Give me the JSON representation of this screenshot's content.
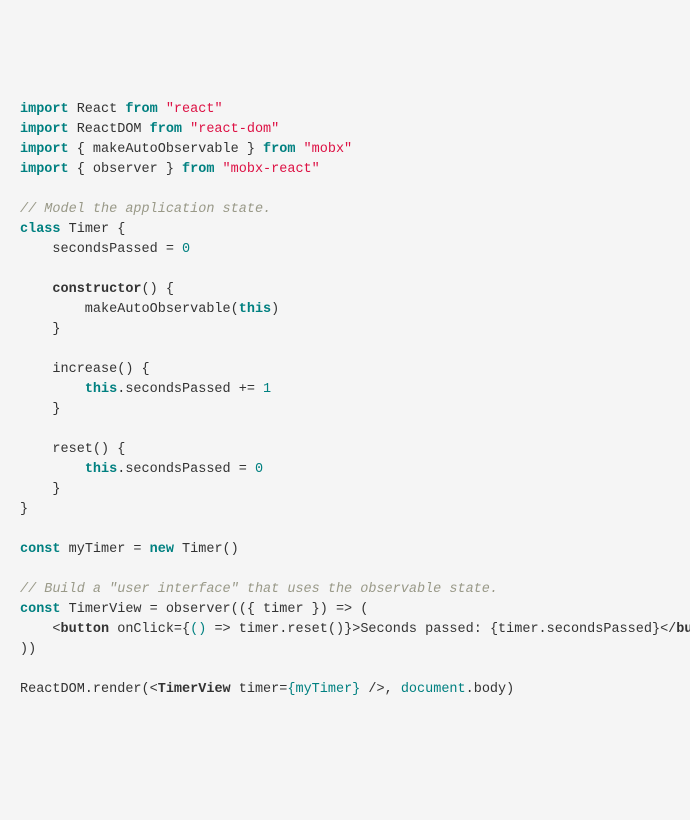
{
  "code": {
    "l1_kw1": "import",
    "l1_id": " React ",
    "l1_kw2": "from",
    "l1_str": " \"react\"",
    "l2_kw1": "import",
    "l2_id": " ReactDOM ",
    "l2_kw2": "from",
    "l2_str": " \"react-dom\"",
    "l3_kw1": "import",
    "l3_id": " { makeAutoObservable } ",
    "l3_kw2": "from",
    "l3_str": " \"mobx\"",
    "l4_kw1": "import",
    "l4_id": " { observer } ",
    "l4_kw2": "from",
    "l4_str": " \"mobx-react\"",
    "blank1": "",
    "l6_cmt": "// Model the application state.",
    "l7_kw": "class",
    "l7_rest": " Timer {",
    "l8_pre": "    secondsPassed = ",
    "l8_num": "0",
    "blank2": "",
    "l10_pre": "    ",
    "l10_fn": "constructor",
    "l10_post": "() {",
    "l11_pre": "        makeAutoObservable(",
    "l11_kw": "this",
    "l11_post": ")",
    "l12": "    }",
    "blank3": "",
    "l14": "    increase() {",
    "l15_pre": "        ",
    "l15_kw": "this",
    "l15_mid": ".secondsPassed += ",
    "l15_num": "1",
    "l16": "    }",
    "blank4": "",
    "l18": "    reset() {",
    "l19_pre": "        ",
    "l19_kw": "this",
    "l19_mid": ".secondsPassed = ",
    "l19_num": "0",
    "l20": "    }",
    "l21": "}",
    "blank5": "",
    "l23_kw": "const",
    "l23_mid": " myTimer = ",
    "l23_kw2": "new",
    "l23_post": " Timer()",
    "blank6": "",
    "l25_cmt": "// Build a \"user interface\" that uses the observable state.",
    "l26_kw": "const",
    "l26_post": " TimerView = observer(({ timer }) => (",
    "l27_pre": "    <",
    "l27_tag1": "button",
    "l27_attr": " onClick=",
    "l27_b1": "{",
    "l27_fn": "()",
    "l27_arrow": " => timer.reset()",
    "l27_b2": "}",
    "l27_gt": ">",
    "l27_text": "Seconds passed: ",
    "l27_expr": "{timer.secondsPassed}",
    "l27_lt": "</",
    "l27_tag2": "button",
    "l27_end": ">",
    "l28": "))",
    "blank7": "",
    "l30_pre": "ReactDOM.render(<",
    "l30_tag": "TimerView",
    "l30_attr": " timer=",
    "l30_expr": "{myTimer}",
    "l30_mid": " />, ",
    "l30_doc": "document",
    "l30_post": ".body)"
  }
}
